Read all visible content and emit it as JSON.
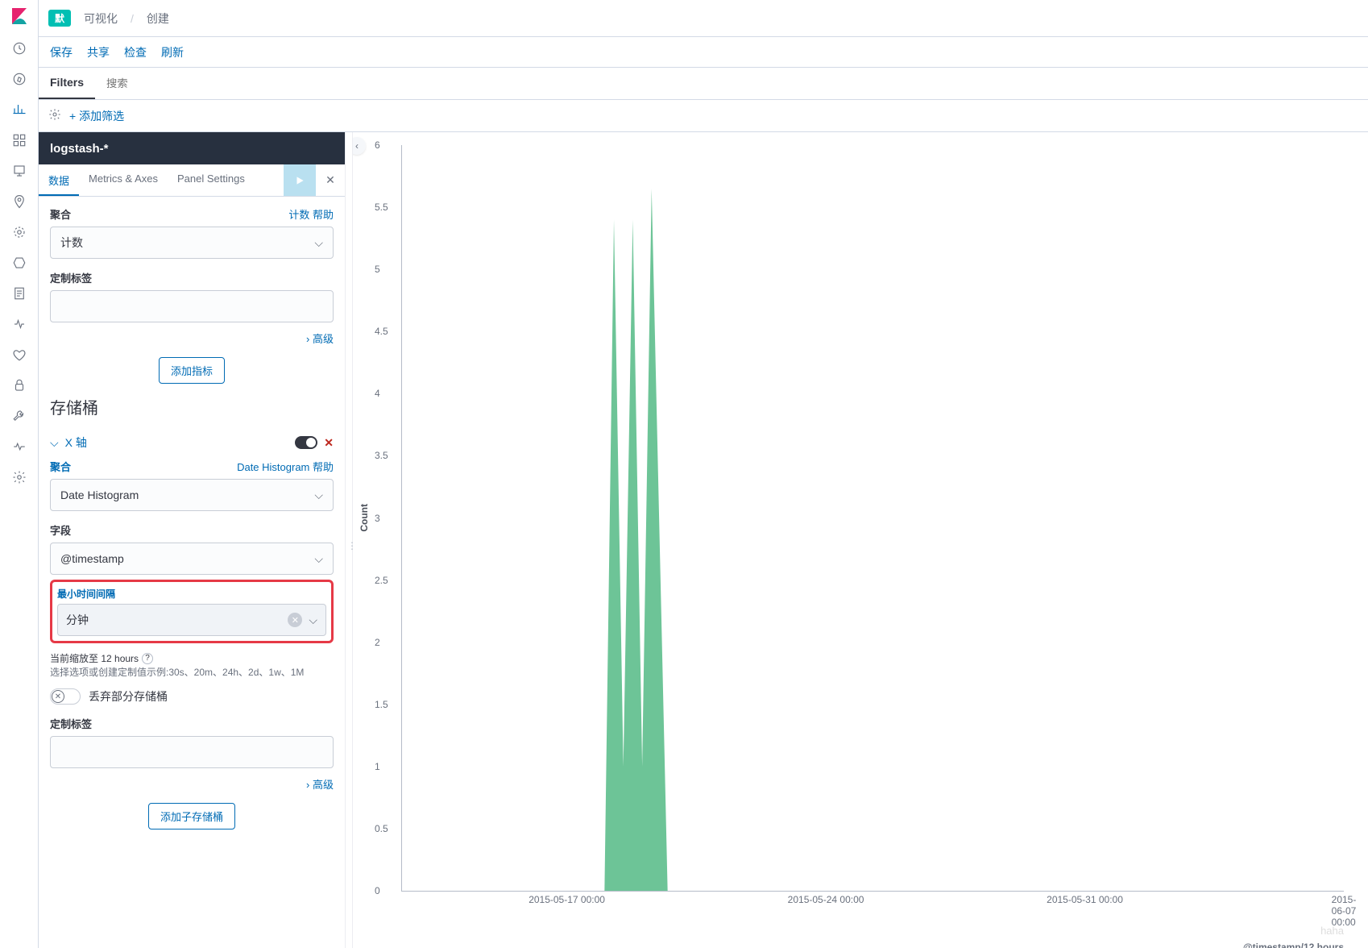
{
  "breadcrumb": {
    "pill": "默",
    "a": "可视化",
    "b": "创建"
  },
  "actions": [
    "保存",
    "共享",
    "检查",
    "刷新"
  ],
  "filterbar": {
    "tab_filters": "Filters",
    "tab_search_ph": "搜索"
  },
  "addfilter": "+ 添加筛选",
  "index_title": "logstash-*",
  "tabs": {
    "data": "数据",
    "metrics": "Metrics & Axes",
    "panel": "Panel Settings"
  },
  "metrics": {
    "agg_label": "聚合",
    "agg_help": "计数 帮助",
    "agg_value": "计数",
    "custom_label": "定制标签",
    "advanced": "高级",
    "add_metric": "添加指标"
  },
  "buckets": {
    "title": "存储桶",
    "xaxis": "X 轴",
    "agg_label": "聚合",
    "agg_help": "Date Histogram 帮助",
    "agg_value": "Date Histogram",
    "field_label": "字段",
    "field_value": "@timestamp",
    "interval_label": "最小时间间隔",
    "interval_value": "分钟",
    "zoom_hint_title": "当前缩放至 12 hours",
    "zoom_hint_body": "选择选项或创建定制值示例:30s、20m、24h、2d、1w、1M",
    "drop_partial": "丢弃部分存储桶",
    "custom_label": "定制标签",
    "advanced": "高级",
    "add_sub": "添加子存储桶"
  },
  "chart_data": {
    "type": "area",
    "ylabel": "Count",
    "ylim": [
      0,
      6
    ],
    "yticks": [
      0,
      0.5,
      1,
      1.5,
      2,
      2.5,
      3,
      3.5,
      4,
      4.5,
      5,
      5.5,
      6
    ],
    "xlabel": "@timestamp/12 hours",
    "xticks": [
      "2015-05-17 00:00",
      "2015-05-24 00:00",
      "2015-05-31 00:00",
      "2015-06-07 00:00"
    ],
    "series": [
      {
        "name": "count",
        "points": [
          {
            "x": 0.215,
            "y": 0
          },
          {
            "x": 0.225,
            "y": 5.4
          },
          {
            "x": 0.235,
            "y": 1.0
          },
          {
            "x": 0.245,
            "y": 5.4
          },
          {
            "x": 0.255,
            "y": 1.0
          },
          {
            "x": 0.265,
            "y": 5.65
          },
          {
            "x": 0.282,
            "y": 0
          }
        ]
      }
    ]
  },
  "watermark": "haha"
}
